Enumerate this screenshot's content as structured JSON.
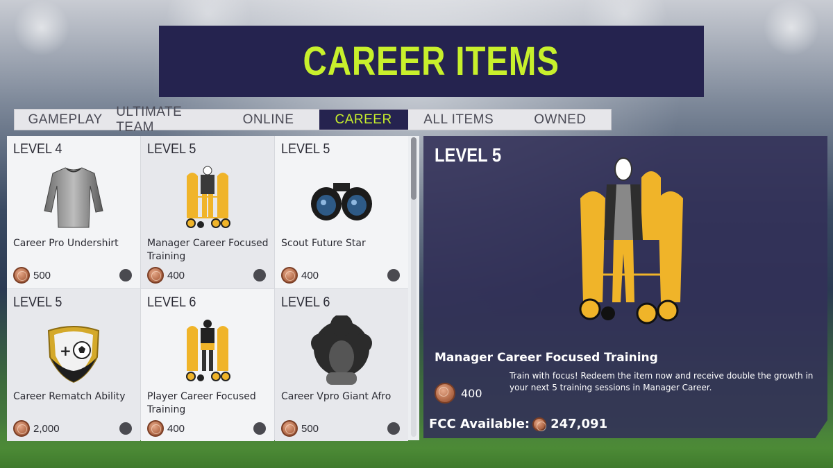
{
  "title": "CAREER ITEMS",
  "tabs": [
    {
      "label": "GAMEPLAY"
    },
    {
      "label": "ULTIMATE TEAM"
    },
    {
      "label": "ONLINE"
    },
    {
      "label": "CAREER",
      "active": true
    },
    {
      "label": "ALL ITEMS"
    },
    {
      "label": "OWNED"
    }
  ],
  "items": [
    {
      "level": "LEVEL 4",
      "name": "Career Pro Undershirt",
      "price": "500",
      "icon": "undershirt-icon"
    },
    {
      "level": "LEVEL 5",
      "name": "Manager Career Focused Training",
      "price": "400",
      "icon": "manager-training-icon"
    },
    {
      "level": "LEVEL 5",
      "name": "Scout Future Star",
      "price": "400",
      "icon": "binoculars-icon"
    },
    {
      "level": "LEVEL 5",
      "name": "Career Rematch Ability",
      "price": "2,000",
      "icon": "rematch-shield-icon"
    },
    {
      "level": "LEVEL 6",
      "name": "Player Career Focused Training",
      "price": "400",
      "icon": "player-training-icon"
    },
    {
      "level": "LEVEL 6",
      "name": "Career Vpro Giant Afro",
      "price": "500",
      "icon": "afro-icon"
    }
  ],
  "detail": {
    "level": "LEVEL 5",
    "name": "Manager Career Focused Training",
    "price": "400",
    "description": "Train with focus! Redeem the item now and receive double the growth in your next 5 training sessions in Manager Career.",
    "fcc_label": "FCC Available:",
    "fcc_value": "247,091"
  },
  "colors": {
    "accent": "#c8f02c",
    "banner": "#25234f"
  }
}
